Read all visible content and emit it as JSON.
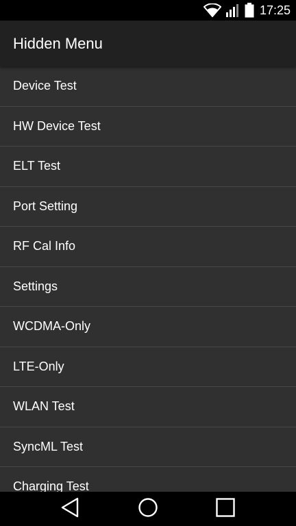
{
  "status_bar": {
    "time": "17:25",
    "icons": [
      "wifi-icon",
      "signal-icon",
      "battery-icon"
    ]
  },
  "app_bar": {
    "title": "Hidden Menu"
  },
  "menu": {
    "items": [
      {
        "label": "Device Test"
      },
      {
        "label": "HW Device Test"
      },
      {
        "label": "ELT Test"
      },
      {
        "label": "Port Setting"
      },
      {
        "label": "RF Cal Info"
      },
      {
        "label": "Settings"
      },
      {
        "label": "WCDMA-Only"
      },
      {
        "label": "LTE-Only"
      },
      {
        "label": "WLAN Test"
      },
      {
        "label": "SyncML Test"
      },
      {
        "label": "Charging Test"
      }
    ]
  },
  "nav_bar": {
    "buttons": [
      "back-icon",
      "home-icon",
      "recents-icon"
    ]
  },
  "colors": {
    "status_bar": "#000000",
    "app_bar": "#212121",
    "background": "#303030",
    "divider": "#474747",
    "text": "#ffffff"
  }
}
